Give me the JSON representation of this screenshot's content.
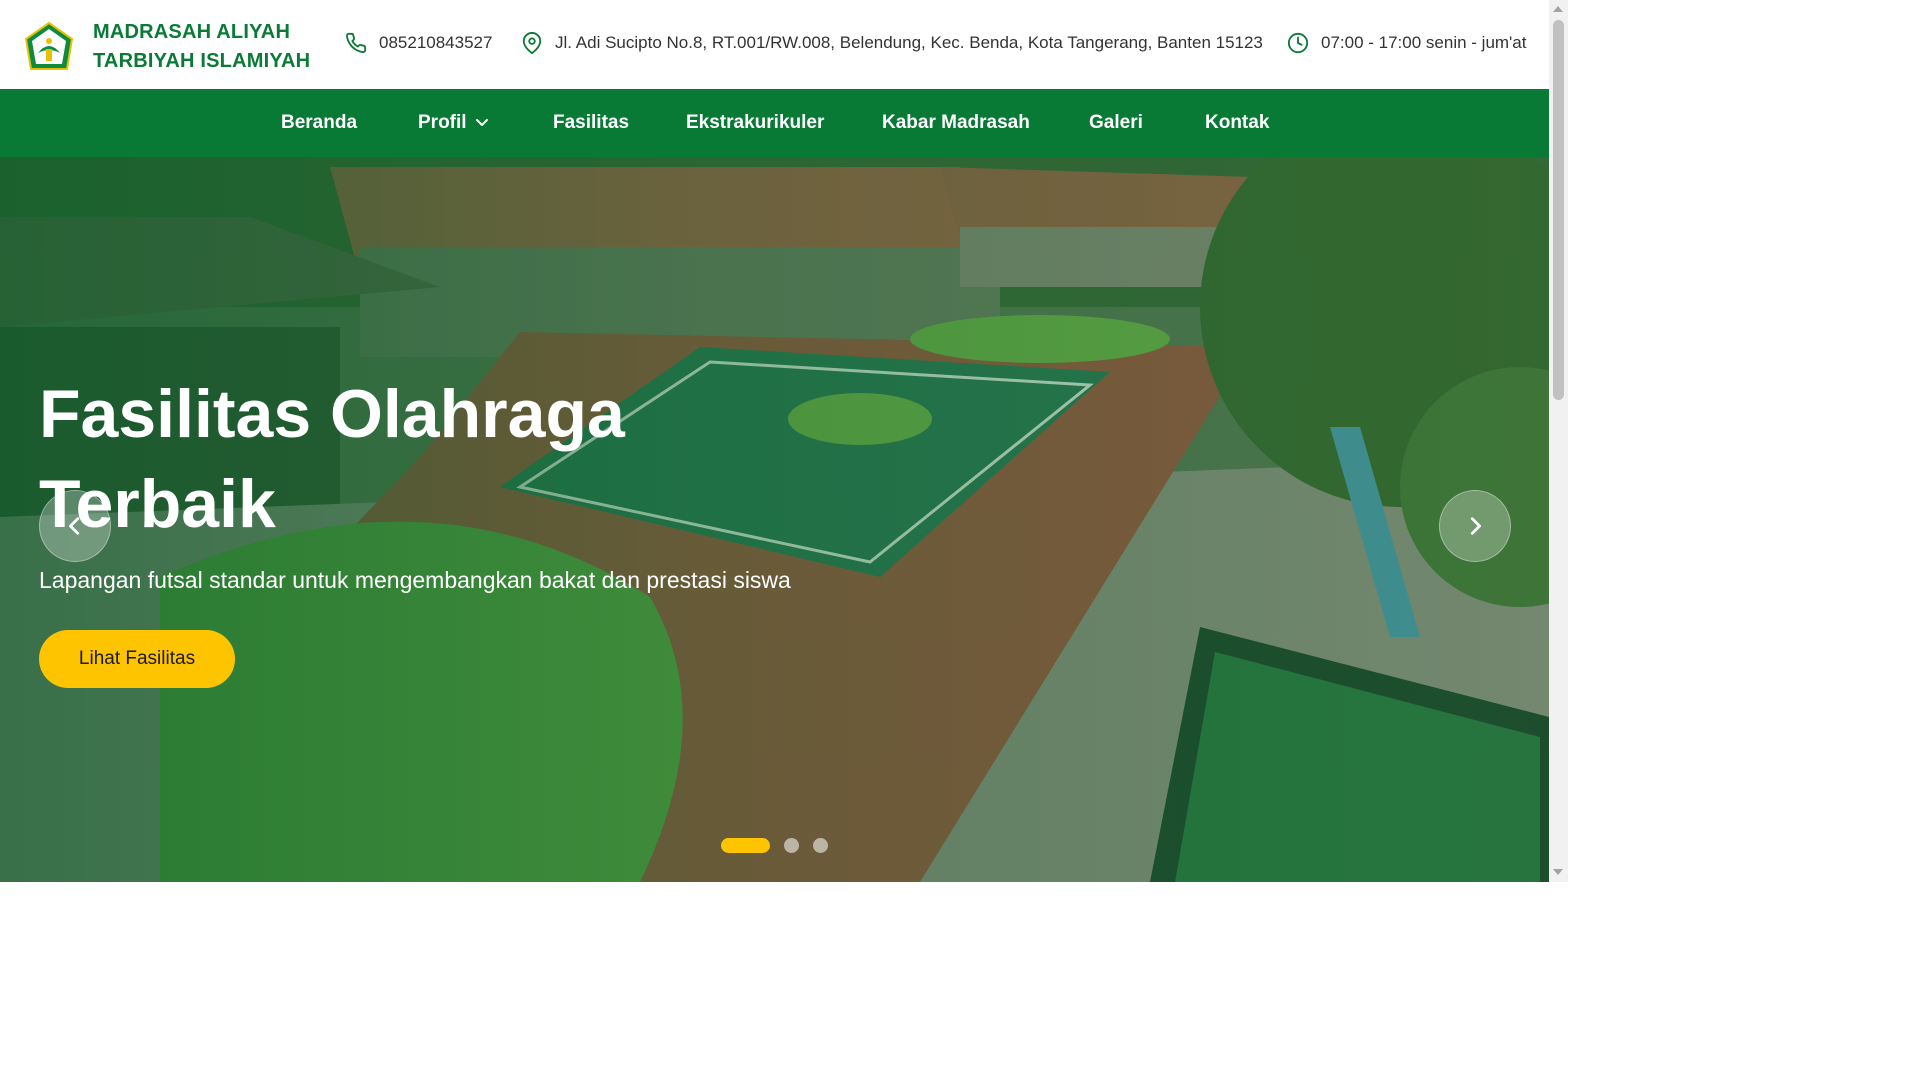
{
  "header": {
    "school_name_line1": "MADRASAH ALIYAH",
    "school_name_line2": "TARBIYAH ISLAMIYAH",
    "phone": "085210843527",
    "address": "Jl. Adi Sucipto No.8, RT.001/RW.008, Belendung, Kec. Benda, Kota Tangerang, Banten 15123",
    "hours": "07:00 - 17:00 senin - jum'at",
    "icons": [
      "logo-icon",
      "phone-icon",
      "location-pin-icon",
      "clock-icon"
    ]
  },
  "nav": {
    "items": [
      {
        "label": "Beranda"
      },
      {
        "label": "Profil",
        "has_dropdown": true
      },
      {
        "label": "Fasilitas"
      },
      {
        "label": "Ekstrakurikuler"
      },
      {
        "label": "Kabar Madrasah"
      },
      {
        "label": "Galeri"
      },
      {
        "label": "Kontak"
      }
    ]
  },
  "hero": {
    "title": "Fasilitas Olahraga Terbaik",
    "subtitle": "Lapangan futsal standar untuk mengembangkan bakat dan prestasi siswa",
    "button_label": "Lihat Fasilitas",
    "slides_total": 3,
    "active_slide": 1
  },
  "colors": {
    "brand_green": "#087a35",
    "accent_yellow": "#ffc400",
    "text_dark": "#333333"
  }
}
